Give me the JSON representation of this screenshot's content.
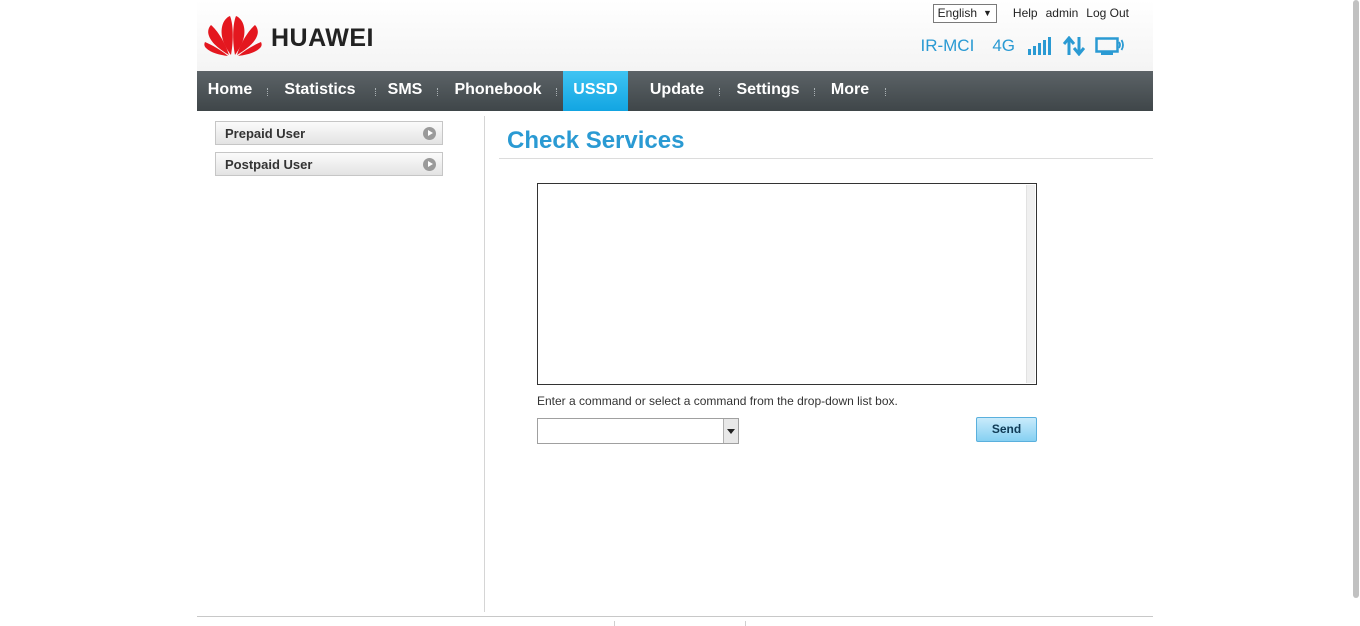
{
  "brand": {
    "name": "HUAWEI",
    "logo_color": "#e4171f"
  },
  "topbar": {
    "language": "English",
    "help": "Help",
    "user": "admin",
    "logout": "Log Out"
  },
  "status": {
    "network": "IR-MCI",
    "rat": "4G",
    "accent": "#2a9ad3",
    "icons": [
      "signal-strength-icon",
      "data-transfer-icon",
      "pc-connection-icon"
    ]
  },
  "nav": {
    "items": [
      {
        "label": "Home"
      },
      {
        "label": "Statistics"
      },
      {
        "label": "SMS"
      },
      {
        "label": "Phonebook"
      },
      {
        "label": "USSD",
        "active": true
      },
      {
        "label": "Update"
      },
      {
        "label": "Settings"
      },
      {
        "label": "More"
      }
    ]
  },
  "sidebar": {
    "items": [
      {
        "label": "Prepaid User"
      },
      {
        "label": "Postpaid User"
      }
    ]
  },
  "main": {
    "title": "Check Services",
    "output_text": "",
    "hint": "Enter a command or select a command from the drop-down list box.",
    "command_value": "",
    "send_label": "Send"
  }
}
